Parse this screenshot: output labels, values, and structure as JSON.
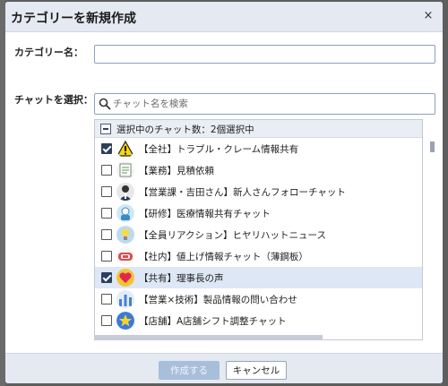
{
  "dialog": {
    "title": "カテゴリーを新規作成",
    "close_glyph": "×"
  },
  "category_name": {
    "label": "カテゴリー名：",
    "value": ""
  },
  "chat_select": {
    "label": "チャットを選択：",
    "search_placeholder": "チャット名を検索",
    "summary": "選択中のチャット数：2個選択中",
    "items": [
      {
        "label": "【全社】トラブル・クレーム情報共有",
        "checked": true,
        "icon": "warning-icon"
      },
      {
        "label": "【業務】見積依頼",
        "checked": false,
        "icon": "document-icon"
      },
      {
        "label": "【営業課・吉田さん】新人さんフォローチャット",
        "checked": false,
        "icon": "person-icon"
      },
      {
        "label": "【研修】医療情報共有チャット",
        "checked": false,
        "icon": "medical-icon"
      },
      {
        "label": "【全員リアクション】ヒヤリハットニュース",
        "checked": false,
        "icon": "lightbulb-icon"
      },
      {
        "label": "【社内】値上げ情報チャット（薄鋼板）",
        "checked": false,
        "icon": "price-up-icon"
      },
      {
        "label": "【共有】理事長の声",
        "checked": true,
        "icon": "heart-icon"
      },
      {
        "label": "【営業×技術】製品情報の問い合わせ",
        "checked": false,
        "icon": "bar-chart-icon"
      },
      {
        "label": "【店舗】A店舗シフト調整チャット",
        "checked": false,
        "icon": "star-icon"
      }
    ]
  },
  "footer": {
    "create_label": "作成する",
    "cancel_label": "キャンセル"
  },
  "colors": {
    "header_bg": "#e4e9f2",
    "accent": "#2d3e5e",
    "selected_row": "#dde7f5",
    "disabled_button": "#a8bfdc"
  }
}
